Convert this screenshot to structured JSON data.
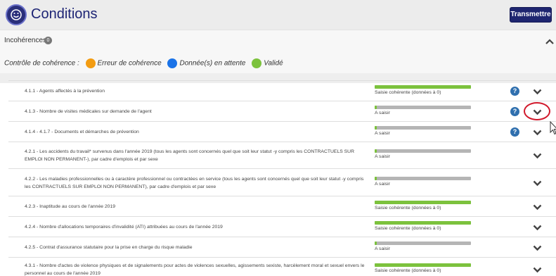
{
  "header": {
    "title": "Conditions",
    "transmit_label": "Transmettre"
  },
  "section": {
    "title": "Incohérences",
    "count": "0",
    "legend_label": "Contrôle de cohérence :",
    "legend": [
      {
        "label": "Erreur de cohérence",
        "color": "#f39c12"
      },
      {
        "label": "Donnée(s) en attente",
        "color": "#1a73e8"
      },
      {
        "label": "Validé",
        "color": "#7cc23d"
      }
    ]
  },
  "rows": [
    {
      "label": "4.1.1 - Agents affectés à la prévention",
      "status": "Saisie cohérente (données à 0)",
      "progress": 1.0,
      "help": true
    },
    {
      "label": "4.1.3 - Nombre de visites médicales sur demande de l'agent",
      "status": "A saisir",
      "progress": 0.02,
      "help": true
    },
    {
      "label": "4.1.4 - 4.1.7 - Documents et démarches de prévention",
      "status": "A saisir",
      "progress": 0.02,
      "help": true
    },
    {
      "label": "4.2.1 - Les accidents du travail* survenus dans l'année 2019 (tous les agents sont concernés quel que soit leur statut -y compris les CONTRACTUELS SUR EMPLOI NON PERMANENT-), par cadre d'emplois et par sexe",
      "status": "A saisir",
      "progress": 0.02,
      "help": false
    },
    {
      "label": "4.2.2 - Les maladies professionnelles ou à caractère professionnel ou contractées en service (tous les agents sont concernés quel que soit leur statut -y compris les CONTRACTUELS SUR EMPLOI NON PERMANENT), par cadre d'emplois et par sexe",
      "status": "A saisir",
      "progress": 0.02,
      "help": false
    },
    {
      "label": "4.2.3 - Inaptitude au cours de l'année 2019",
      "status": "Saisie cohérente (données à 0)",
      "progress": 1.0,
      "help": false
    },
    {
      "label": "4.2.4 - Nombre d'allocations temporaires d'invalidité (ATI) attribuées au cours de l'année 2019",
      "status": "Saisie cohérente (données à 0)",
      "progress": 1.0,
      "help": false
    },
    {
      "label": "4.2.5 - Contrat d'assurance statutaire pour la prise en charge du risque maladie",
      "status": "A saisir",
      "progress": 0.02,
      "help": false
    },
    {
      "label": "4.3.1 - Nombre d'actes de violence physiques et de signalements pour actes de violences sexuelles, agissements sexiste, harcèlement moral et sexuel envers le personnel au cours de l'année 2019",
      "status": "Saisie cohérente (données à 0)",
      "progress": 1.0,
      "help": false
    }
  ]
}
